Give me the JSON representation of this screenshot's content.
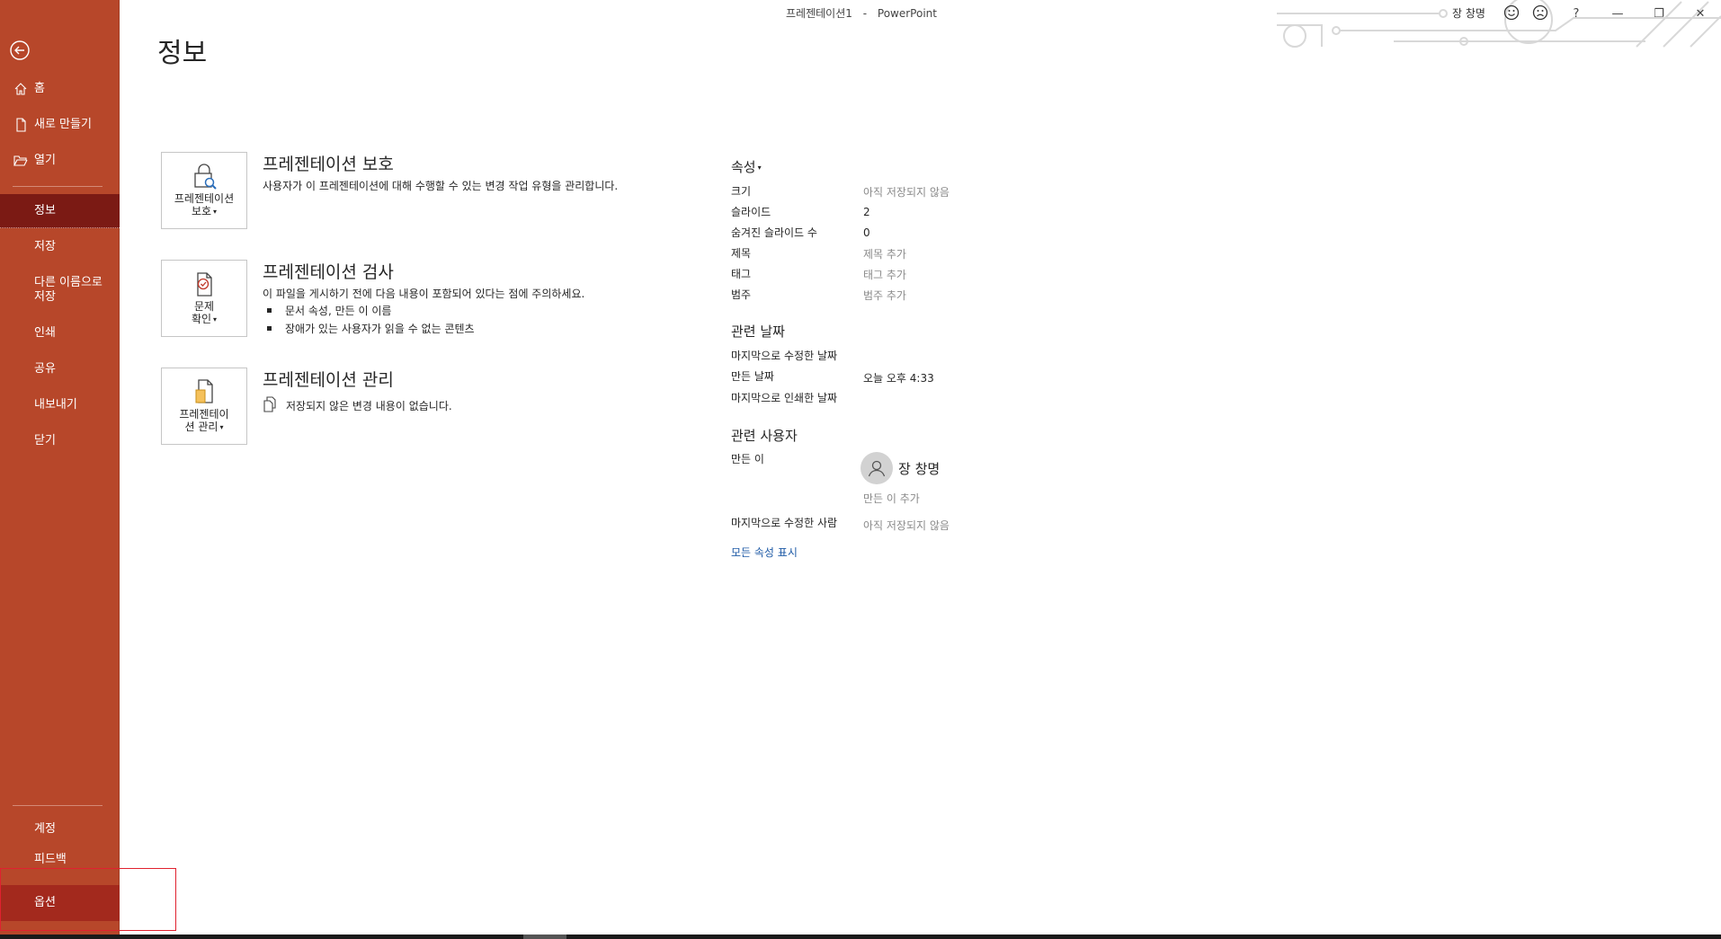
{
  "window": {
    "doc_name": "프레젠테이션1",
    "separator": "-",
    "app_name": "PowerPoint",
    "user_name": "장 창명",
    "help": "?",
    "minimize": "—",
    "restore": "❐",
    "close": "✕"
  },
  "sidebar": {
    "home": "홈",
    "new": "새로 만들기",
    "open": "열기",
    "info": "정보",
    "save": "저장",
    "save_as": "다른 이름으로\n저장",
    "print": "인쇄",
    "share": "공유",
    "export": "내보내기",
    "close": "닫기",
    "account": "계정",
    "feedback": "피드백",
    "options": "옵션"
  },
  "main": {
    "title": "정보",
    "protect": {
      "tile_label": "프레젠테이션\n보호",
      "title": "프레젠테이션 보호",
      "desc": "사용자가 이 프레젠테이션에 대해 수행할 수 있는 변경 작업 유형을 관리합니다."
    },
    "inspect": {
      "tile_label": "문제\n확인",
      "title": "프레젠테이션 검사",
      "desc": "이 파일을 게시하기 전에 다음 내용이 포함되어 있다는 점에 주의하세요.",
      "bullets": [
        "문서 속성, 만든 이 이름",
        "장애가 있는 사용자가 읽을 수 없는 콘텐츠"
      ]
    },
    "manage": {
      "tile_label": "프레젠테이\n션 관리",
      "title": "프레젠테이션 관리",
      "desc": "저장되지 않은 변경 내용이 없습니다."
    }
  },
  "properties": {
    "heading": "속성",
    "rows": [
      {
        "label": "크기",
        "value": "아직 저장되지 않음"
      },
      {
        "label": "슬라이드",
        "value": "2"
      },
      {
        "label": "숨겨진 슬라이드 수",
        "value": "0"
      },
      {
        "label": "제목",
        "value": "제목 추가"
      },
      {
        "label": "태그",
        "value": "태그 추가"
      },
      {
        "label": "범주",
        "value": "범주 추가"
      }
    ],
    "dates_heading": "관련 날짜",
    "dates": [
      {
        "label": "마지막으로 수정한 날짜",
        "value": ""
      },
      {
        "label": "만든 날짜",
        "value": "오늘 오후 4:33"
      },
      {
        "label": "마지막으로 인쇄한 날짜",
        "value": ""
      }
    ],
    "people_heading": "관련 사용자",
    "author_label": "만든 이",
    "author_name": "장 창명",
    "add_author": "만든 이 추가",
    "last_modified_by_label": "마지막으로 수정한 사람",
    "last_modified_by_value": "아직 저장되지 않음",
    "show_all": "모든 속성 표시"
  }
}
